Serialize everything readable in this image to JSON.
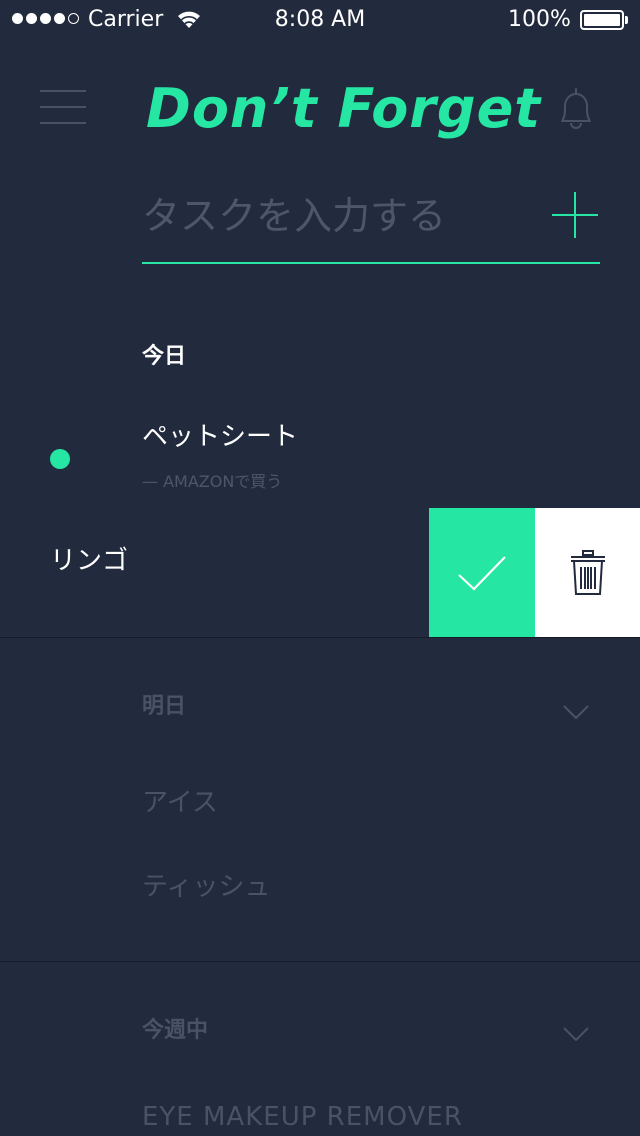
{
  "status_bar": {
    "carrier": "Carrier",
    "time": "8:08 AM",
    "battery": "100%",
    "signal_bars_filled": 4,
    "signal_bars_total": 5
  },
  "header": {
    "title": "Don’t Forget",
    "menu_icon": "hamburger-menu-icon",
    "bell_icon": "bell-icon"
  },
  "input": {
    "placeholder": "タスクを入力する",
    "add_icon": "plus-icon"
  },
  "sections": {
    "today": {
      "heading": "今日",
      "tasks": [
        {
          "title": "ペットシート",
          "note": "— AMAZONで買う",
          "active": true
        },
        {
          "title": "リンゴ"
        }
      ]
    },
    "tomorrow": {
      "heading": "明日",
      "tasks": [
        {
          "title": "アイス"
        },
        {
          "title": "ティッシュ"
        }
      ]
    },
    "this_week": {
      "heading": "今週中",
      "tasks": [
        {
          "title": "EYE MAKEUP REMOVER"
        }
      ]
    }
  },
  "swipe_actions": {
    "complete_icon": "checkmark-icon",
    "delete_icon": "trash-icon"
  },
  "colors": {
    "background": "#222a3d",
    "accent": "#25e6a3",
    "muted": "#4a5266",
    "divider": "#151b29",
    "white": "#ffffff"
  }
}
